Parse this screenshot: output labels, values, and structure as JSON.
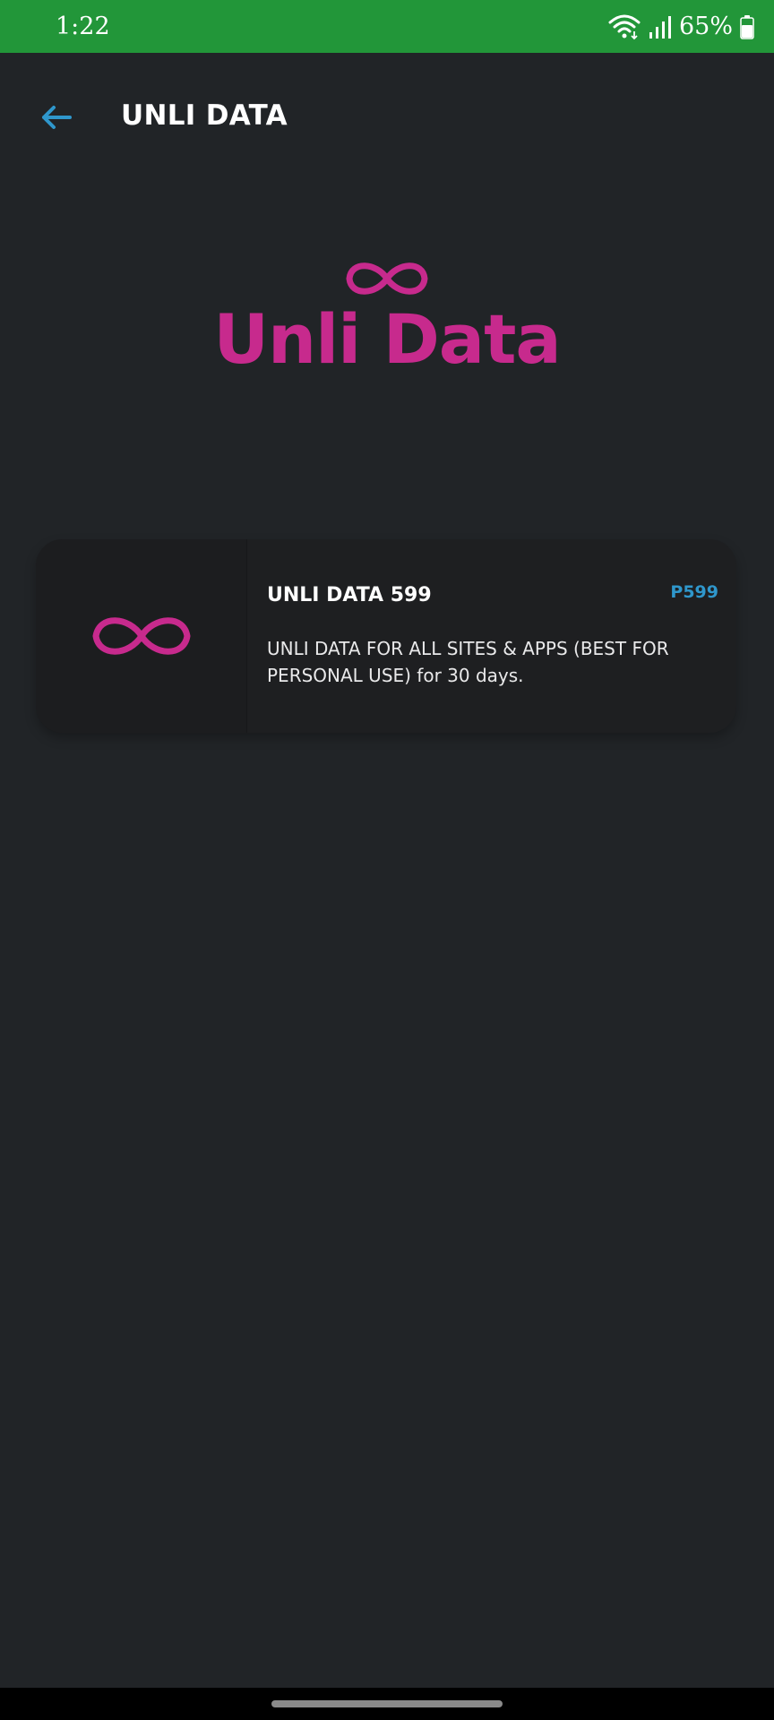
{
  "status_bar": {
    "time": "1:22",
    "battery": "65%",
    "icons": [
      "wifi-icon",
      "signal-icon",
      "battery-icon"
    ]
  },
  "header": {
    "title": "UNLI DATA",
    "back_icon": "arrow-left-icon"
  },
  "hero": {
    "logo_icon": "infinity-icon",
    "title": "Unli Data"
  },
  "plans": [
    {
      "title": "UNLI DATA 599",
      "price": "P599",
      "description": "UNLI DATA FOR ALL SITES & APPS (BEST FOR PERSONAL USE) for 30 days.",
      "icon": "infinity-icon"
    }
  ],
  "colors": {
    "status_bar": "#229639",
    "background": "#212427",
    "brand_pink": "#c72a8d",
    "accent_blue": "#2f97cc",
    "card": "#1e1f21"
  }
}
